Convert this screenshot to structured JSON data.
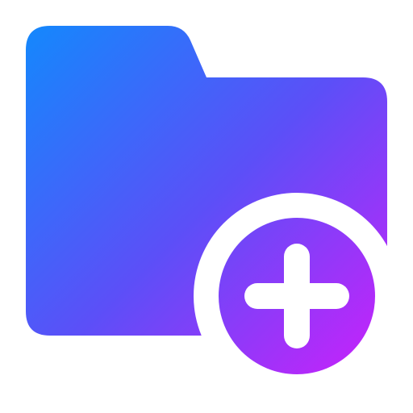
{
  "icon": {
    "name": "folder-add-icon",
    "badge_icon": "plus-circle-icon",
    "colors": {
      "gradient_start": "#1488fc",
      "gradient_mid": "#5c4ff8",
      "gradient_end": "#d01efa",
      "background": "#ffffff",
      "glyph": "#ffffff"
    }
  }
}
